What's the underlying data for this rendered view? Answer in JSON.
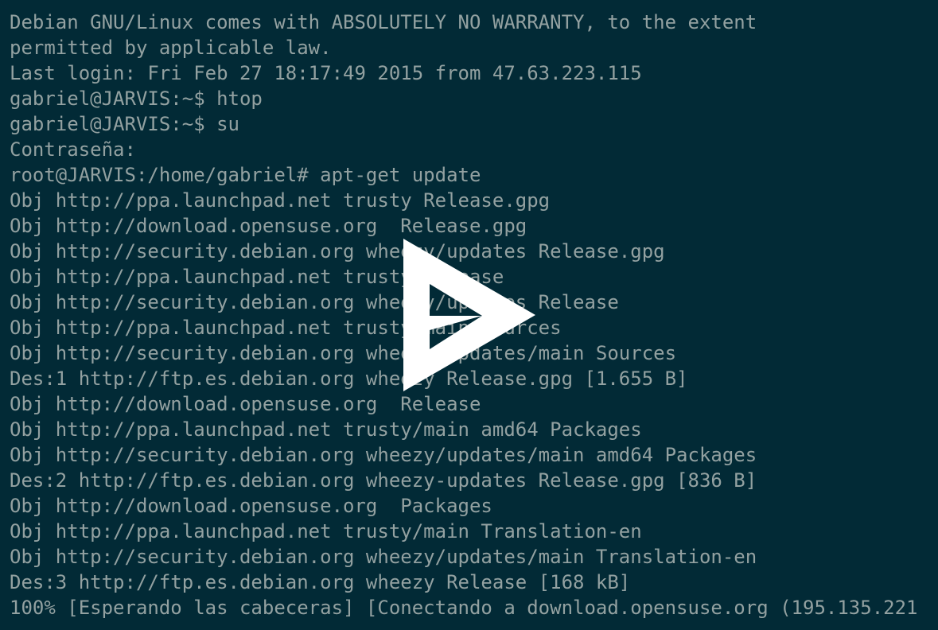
{
  "terminal": {
    "lines": [
      "Debian GNU/Linux comes with ABSOLUTELY NO WARRANTY, to the extent",
      "permitted by applicable law.",
      "Last login: Fri Feb 27 18:17:49 2015 from 47.63.223.115",
      "gabriel@JARVIS:~$ htop",
      "gabriel@JARVIS:~$ su",
      "Contraseña:",
      "root@JARVIS:/home/gabriel# apt-get update",
      "Obj http://ppa.launchpad.net trusty Release.gpg",
      "Obj http://download.opensuse.org  Release.gpg",
      "Obj http://security.debian.org wheezy/updates Release.gpg",
      "Obj http://ppa.launchpad.net trusty Release",
      "Obj http://security.debian.org wheezy/updates Release",
      "Obj http://ppa.launchpad.net trusty/main Sources",
      "Obj http://security.debian.org wheezy/updates/main Sources",
      "Des:1 http://ftp.es.debian.org wheezy Release.gpg [1.655 B]",
      "Obj http://download.opensuse.org  Release",
      "Obj http://ppa.launchpad.net trusty/main amd64 Packages",
      "Obj http://security.debian.org wheezy/updates/main amd64 Packages",
      "Des:2 http://ftp.es.debian.org wheezy-updates Release.gpg [836 B]",
      "Obj http://download.opensuse.org  Packages",
      "Obj http://ppa.launchpad.net trusty/main Translation-en",
      "Obj http://security.debian.org wheezy/updates/main Translation-en",
      "Des:3 http://ftp.es.debian.org wheezy Release [168 kB]",
      "100% [Esperando las cabeceras] [Conectando a download.opensuse.org (195.135.221"
    ]
  },
  "overlay": {
    "icon": "play-icon"
  },
  "colors": {
    "background": "#022a36",
    "text": "#93a1a1",
    "overlay": "#ffffff"
  }
}
